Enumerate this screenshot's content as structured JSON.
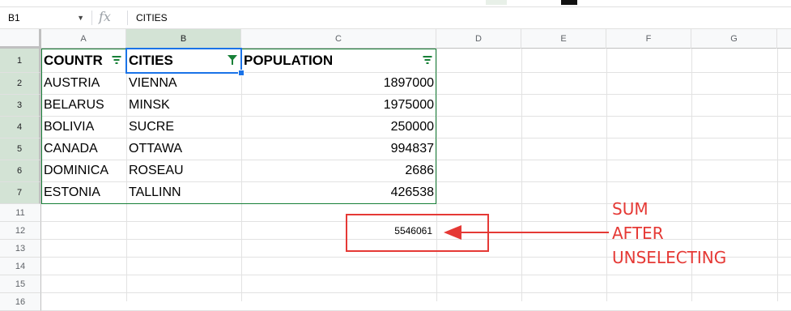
{
  "formula_bar": {
    "name_box": "B1",
    "fx_label": "fx",
    "formula": "CITIES"
  },
  "columns": [
    "A",
    "B",
    "C",
    "D",
    "E",
    "F",
    "G"
  ],
  "headers": {
    "a": "COUNTR",
    "b": "CITIES",
    "c": "POPULATION"
  },
  "rows": [
    {
      "num": "1"
    },
    {
      "num": "2",
      "country": "AUSTRIA",
      "city": "VIENNA",
      "population": "1897000"
    },
    {
      "num": "3",
      "country": "BELARUS",
      "city": "MINSK",
      "population": "1975000"
    },
    {
      "num": "4",
      "country": "BOLIVIA",
      "city": "SUCRE",
      "population": "250000"
    },
    {
      "num": "5",
      "country": "CANADA",
      "city": "OTTAWA",
      "population": "994837"
    },
    {
      "num": "6",
      "country": "DOMINICA",
      "city": "ROSEAU",
      "population": "2686"
    },
    {
      "num": "7",
      "country": "ESTONIA",
      "city": "TALLINN",
      "population": "426538"
    },
    {
      "num": "11"
    },
    {
      "num": "12",
      "sum": "5546061"
    },
    {
      "num": "13"
    },
    {
      "num": "14"
    },
    {
      "num": "15"
    },
    {
      "num": "16"
    }
  ],
  "annotation": {
    "line1": "SUM",
    "line2": "AFTER",
    "line3": "UNSELECTING",
    "color": "#e53935"
  },
  "colors": {
    "filter_green": "#188038",
    "selection_blue": "#1a73e8",
    "header_selected": "#d3e3d5"
  }
}
